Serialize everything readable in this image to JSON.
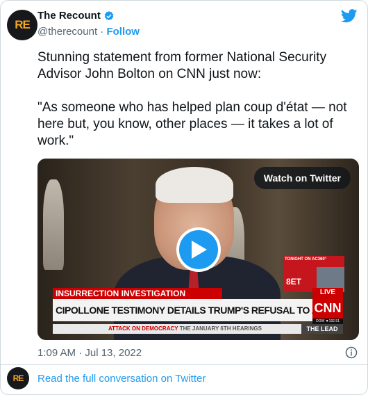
{
  "account": {
    "avatar_text": "RE",
    "name": "The Recount",
    "handle": "@therecount",
    "separator": "·",
    "follow_label": "Follow"
  },
  "tweet": {
    "text": "Stunning statement from former National Security Advisor John Bolton on CNN just now:\n\n\"As someone who has helped plan coup d'état — not here but, you know, other places — it takes a lot of work.\"",
    "timestamp": "1:09 AM · Jul 13, 2022"
  },
  "media": {
    "watch_label": "Watch on Twitter",
    "tonight_label": "TONIGHT ON AC360°",
    "tonight_time": "8ET",
    "banner_top": "INSURRECTION INVESTIGATION",
    "banner_main": "CIPOLLONE TESTIMONY DETAILS TRUMP'S REFUSAL TO ACCEPT ELECTION RESULTS",
    "live_label": "LIVE",
    "network": "CNN",
    "dow": "DOW ▼192.51",
    "ticker_red": "ATTACK ON DEMOCRACY",
    "ticker_dark": "THE JANUARY 6TH HEARINGS",
    "lead": "THE LEAD"
  },
  "footer": {
    "avatar_text": "RE",
    "link_label": "Read the full conversation on Twitter"
  },
  "colors": {
    "accent": "#1d9bf0",
    "cnn_red": "#cc0000"
  },
  "icons": [
    "verified-badge-icon",
    "twitter-bird-icon",
    "play-icon",
    "info-icon"
  ]
}
